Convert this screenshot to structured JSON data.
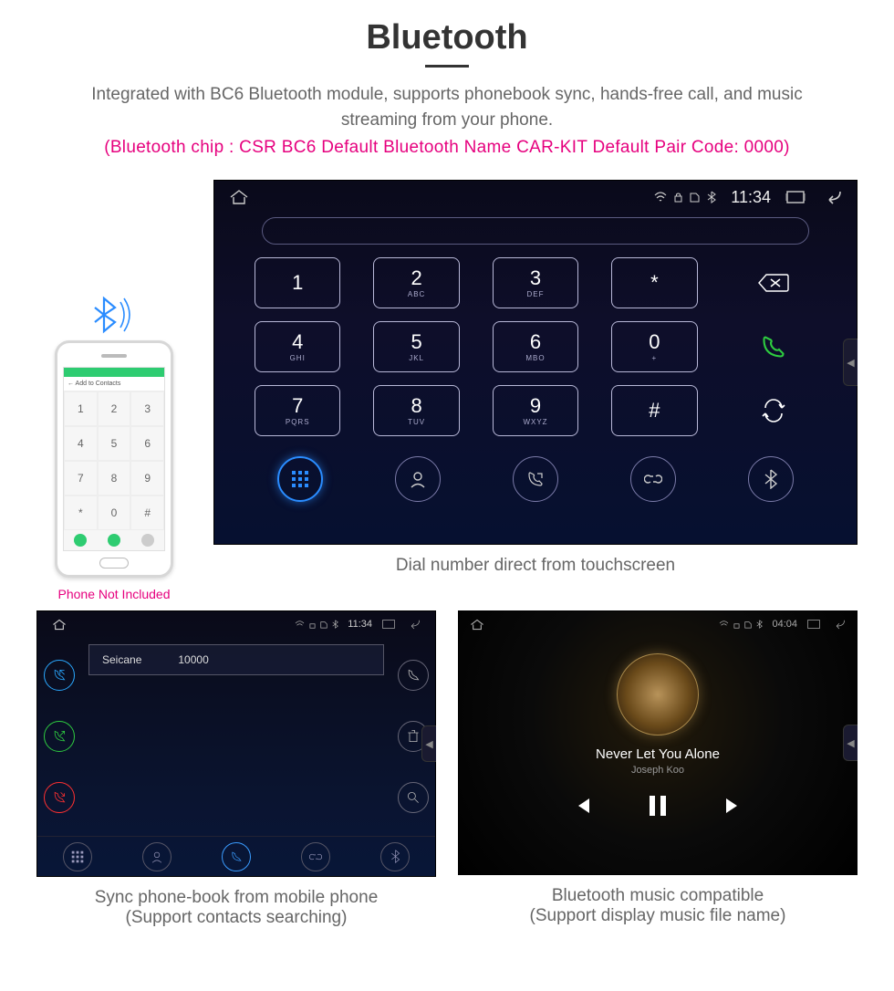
{
  "header": {
    "title": "Bluetooth",
    "description": "Integrated with BC6 Bluetooth module, supports phonebook sync, hands-free call, and music streaming from your phone.",
    "specs": "(Bluetooth chip : CSR BC6     Default Bluetooth Name CAR-KIT     Default Pair Code: 0000)"
  },
  "phone": {
    "titlebar": "←   Add to Contacts",
    "caption": "Phone Not Included",
    "keys": [
      "1",
      "2",
      "3",
      "4",
      "5",
      "6",
      "7",
      "8",
      "9",
      "*",
      "0",
      "#"
    ]
  },
  "dialer": {
    "time": "11:34",
    "keys": [
      {
        "digit": "1",
        "sub": ""
      },
      {
        "digit": "2",
        "sub": "ABC"
      },
      {
        "digit": "3",
        "sub": "DEF"
      },
      {
        "digit": "*",
        "sub": ""
      },
      {
        "digit": "⌫",
        "sub": "",
        "action": "backspace"
      },
      {
        "digit": "4",
        "sub": "GHI"
      },
      {
        "digit": "5",
        "sub": "JKL"
      },
      {
        "digit": "6",
        "sub": "MBO"
      },
      {
        "digit": "0",
        "sub": "+"
      },
      {
        "digit": "call",
        "sub": "",
        "action": "call"
      },
      {
        "digit": "7",
        "sub": "PQRS"
      },
      {
        "digit": "8",
        "sub": "TUV"
      },
      {
        "digit": "9",
        "sub": "WXYZ"
      },
      {
        "digit": "#",
        "sub": ""
      },
      {
        "digit": "sync",
        "sub": "",
        "action": "sync"
      }
    ],
    "caption": "Dial number direct from touchscreen"
  },
  "phonebook": {
    "time": "11:34",
    "entry_name": "Seicane",
    "entry_number": "10000",
    "caption_line1": "Sync phone-book from mobile phone",
    "caption_line2": "(Support contacts searching)"
  },
  "music": {
    "time": "04:04",
    "title": "Never Let You Alone",
    "artist": "Joseph Koo",
    "caption_line1": "Bluetooth music compatible",
    "caption_line2": "(Support display music file name)"
  }
}
